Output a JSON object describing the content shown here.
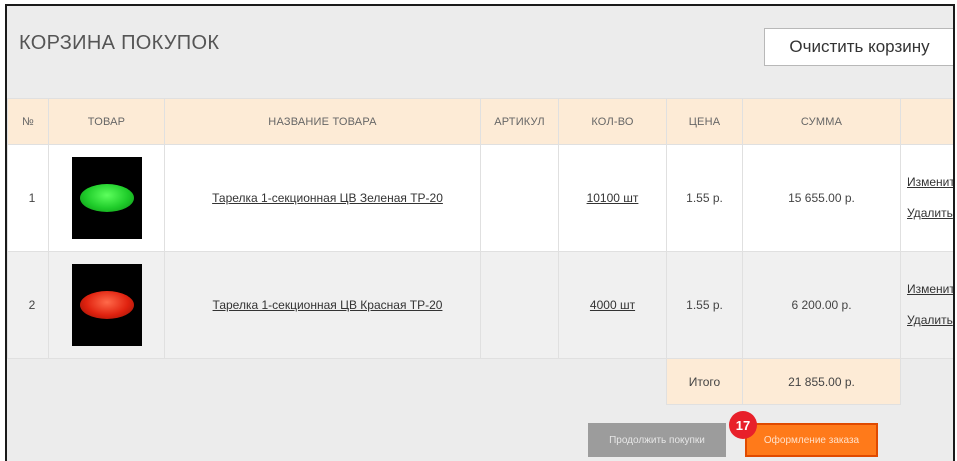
{
  "cart": {
    "title": "КОРЗИНА ПОКУПОК",
    "clear_label": "Очистить корзину"
  },
  "table": {
    "headers": [
      "№",
      "ТОВАР",
      "НАЗВАНИЕ ТОВАРА",
      "АРТИКУЛ",
      "КОЛ-ВО",
      "ЦЕНА",
      "СУММА",
      ""
    ],
    "rows": [
      {
        "num": "1",
        "image": "green-plate",
        "name": "Тарелка 1-секционная ЦВ Зеленая ТР-20",
        "article": "",
        "qty": "10100 шт",
        "price": "1.55 р.",
        "sum": "15 655.00 р.",
        "edit": "Изменить",
        "delete": "Удалить"
      },
      {
        "num": "2",
        "image": "red-plate",
        "name": "Тарелка 1-секционная ЦВ Красная ТР-20",
        "article": "",
        "qty": "4000 шт",
        "price": "1.55 р.",
        "sum": "6 200.00 р.",
        "edit": "Изменить",
        "delete": "Удалить"
      }
    ],
    "total_label": "Итого",
    "total_value": "21 855.00 р."
  },
  "actions": {
    "continue_label": "Продолжить покупки",
    "checkout_label": "Оформление заказа",
    "badge_count": "17"
  },
  "colors": {
    "header_bg": "#fdebd6",
    "checkout": "#ff7a1a",
    "badge": "#e8202a"
  }
}
